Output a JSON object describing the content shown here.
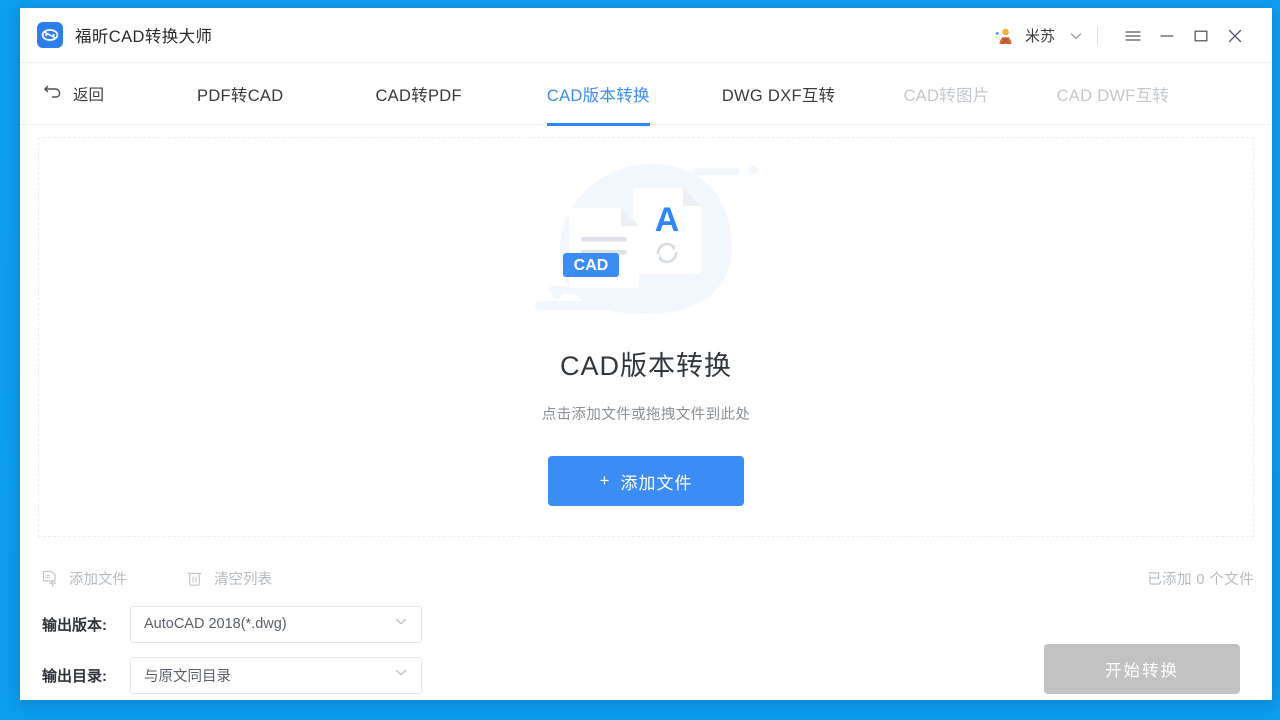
{
  "window": {
    "app_title": "福昕CAD转换大师",
    "logo_icon": "cad-logo-icon"
  },
  "titlebar": {
    "avatar_icon": "user-avatar-icon",
    "user_name": "米苏",
    "dropdown_icon": "chevron-down-icon",
    "menu_icon": "hamburger-menu-icon",
    "minimize_icon": "minimize-icon",
    "maximize_icon": "maximize-icon",
    "close_icon": "close-icon"
  },
  "nav": {
    "back_icon": "back-arrow-icon",
    "back_label": "返回",
    "tabs": [
      {
        "label": "PDF转CAD",
        "state": "normal"
      },
      {
        "label": "CAD转PDF",
        "state": "normal"
      },
      {
        "label": "CAD版本转换",
        "state": "active"
      },
      {
        "label": "DWG DXF互转",
        "state": "normal"
      },
      {
        "label": "CAD转图片",
        "state": "disabled"
      },
      {
        "label": "CAD DWF互转",
        "state": "disabled"
      }
    ]
  },
  "dropzone": {
    "illustration_icon": "cad-document-convert-illustration",
    "illustration_badge": "CAD",
    "illustration_letter": "A",
    "title": "CAD版本转换",
    "subtitle": "点击添加文件或拖拽文件到此处",
    "add_button_plus": "+",
    "add_button_label": "添加文件"
  },
  "actionbar": {
    "add_file_icon": "add-file-icon",
    "add_file_label": "添加文件",
    "clear_list_icon": "trash-icon",
    "clear_list_label": "清空列表",
    "file_count_text": "已添加 0 个文件"
  },
  "form": {
    "version_label": "输出版本:",
    "version_value": "AutoCAD 2018(*.dwg)",
    "version_chevron_icon": "chevron-down-icon",
    "directory_label": "输出目录:",
    "directory_value": "与原文同目录",
    "directory_chevron_icon": "chevron-down-icon",
    "start_label": "开始转换"
  },
  "colors": {
    "accent": "#3c8cf5",
    "tab_active": "#3c8cf5",
    "desktop_background": "#0e9ef0",
    "disabled_button": "#c2c2c2",
    "muted_text": "#b6bbc1"
  }
}
